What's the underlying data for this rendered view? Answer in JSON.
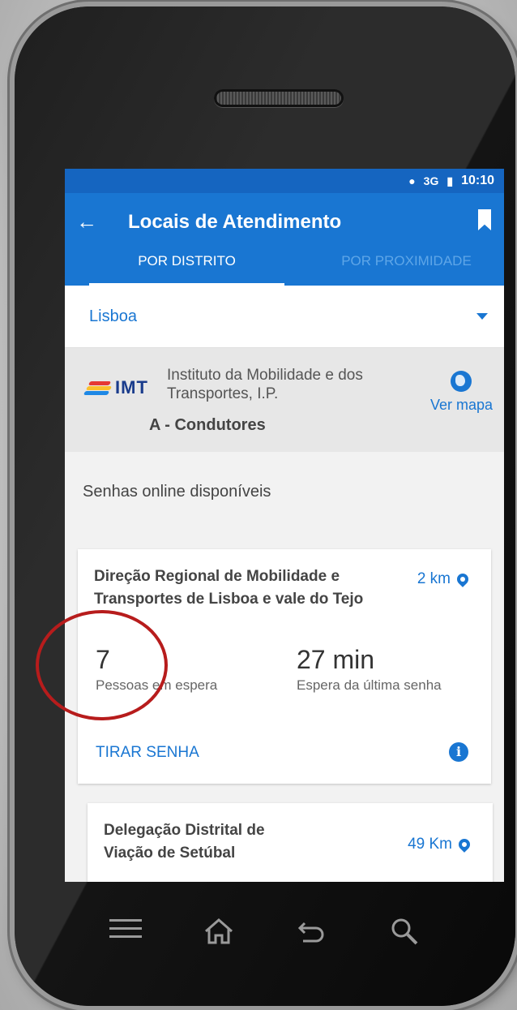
{
  "status_bar": {
    "network": "3G",
    "time": "10:10"
  },
  "header": {
    "title": "Locais de Atendimento"
  },
  "tabs": [
    {
      "label": "POR DISTRITO",
      "active": true
    },
    {
      "label": "POR PROXIMIDADE",
      "active": false
    }
  ],
  "district_select": {
    "value": "Lisboa"
  },
  "organization": {
    "logo_text": "IMT",
    "name": "Instituto da Mobilidade e dos Transportes, I.P.",
    "section": "A - Condutores",
    "map_label": "Ver mapa"
  },
  "section_title": "Senhas online disponíveis",
  "locations": [
    {
      "title": "Direção Regional de Mobilidade e Transportes de Lisboa e vale do Tejo",
      "distance": "2 km",
      "waiting_count": "7",
      "waiting_label": "Pessoas em espera",
      "last_wait": "27 min",
      "last_wait_label": "Espera da última senha",
      "action": "TIRAR SENHA"
    },
    {
      "title": "Delegação Distrital de Viação de Setúbal",
      "distance": "49 Km"
    }
  ],
  "colors": {
    "primary": "#1976d2",
    "highlight_circle": "#b71c1c"
  }
}
